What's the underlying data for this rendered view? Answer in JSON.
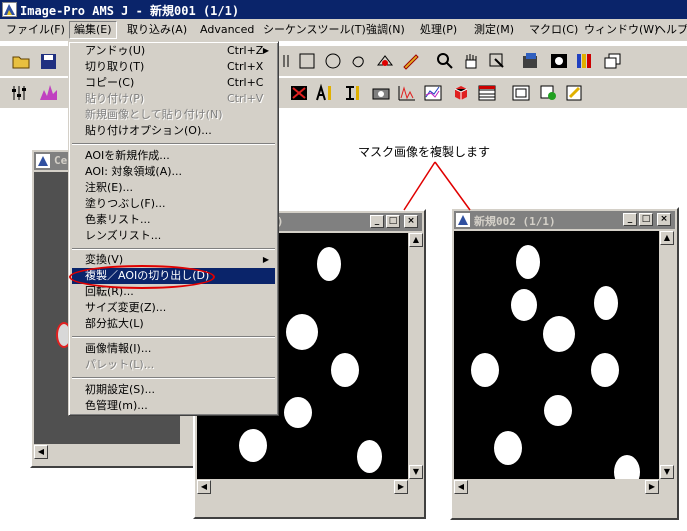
{
  "window": {
    "title": "Image-Pro AMS J - 新規001 (1/1)"
  },
  "menubar": [
    {
      "label": "ファイル(F)"
    },
    {
      "label": "編集(E)"
    },
    {
      "label": "取り込み(A)"
    },
    {
      "label": "Advanced"
    },
    {
      "label": "シーケンスツール(T)"
    },
    {
      "label": "強調(N)"
    },
    {
      "label": "処理(P)"
    },
    {
      "label": "測定(M)"
    },
    {
      "label": "マクロ(C)"
    },
    {
      "label": "ウィンドウ(W)"
    },
    {
      "label": "ヘルプ"
    }
  ],
  "edit_menu": {
    "items": [
      {
        "label": "アンドゥ(U)",
        "shortcut": "Ctrl+Z"
      },
      {
        "label": "切り取り(T)",
        "shortcut": "Ctrl+X"
      },
      {
        "label": "コピー(C)",
        "shortcut": "Ctrl+C"
      },
      {
        "label": "貼り付け(P)",
        "shortcut": "Ctrl+V"
      },
      {
        "label": "新規画像として貼り付け(N)"
      },
      {
        "label": "貼り付けオプション(O)..."
      },
      {
        "label": "AOIを新規作成..."
      },
      {
        "label": "AOI: 対象領域(A)..."
      },
      {
        "label": "注釈(E)..."
      },
      {
        "label": "塗りつぶし(F)..."
      },
      {
        "label": "色素リスト..."
      },
      {
        "label": "レンズリスト..."
      },
      {
        "label": "変換(V)"
      },
      {
        "label": "複製／AOIの切り出し(D)"
      },
      {
        "label": "回転(R)..."
      },
      {
        "label": "サイズ変更(Z)..."
      },
      {
        "label": "部分拡大(L)"
      },
      {
        "label": "画像情報(I)..."
      },
      {
        "label": "パレット(L)..."
      },
      {
        "label": "初期設定(S)..."
      },
      {
        "label": "色管理(m)..."
      }
    ]
  },
  "annotation": {
    "text": "マスク画像を複製します"
  },
  "image_windows": [
    {
      "title": "Ce"
    },
    {
      "title": "1/1)"
    },
    {
      "title": "新規002 (1/1)"
    }
  ],
  "colors": {
    "title_active": "#0a246a",
    "title_inactive": "#808080",
    "face": "#d4d0c8",
    "annotation": "#e00000"
  }
}
